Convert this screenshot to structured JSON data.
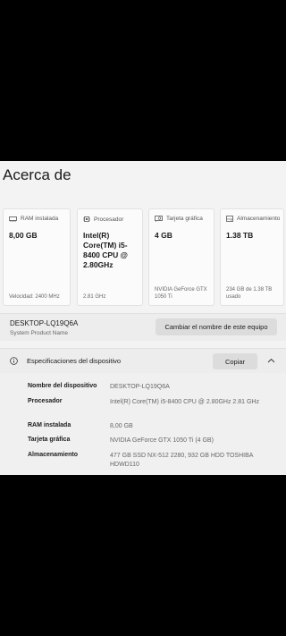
{
  "page": {
    "title": "Acerca de"
  },
  "cards": [
    {
      "header": "RAM instalada",
      "icon": "memory-icon",
      "main": "8,00 GB",
      "sub": "Velocidad: 2400 MHz"
    },
    {
      "header": "Procesador",
      "icon": "cpu-icon",
      "main": "Intel(R) Core(TM) i5-8400 CPU @ 2.80GHz",
      "sub": "2.81 GHz"
    },
    {
      "header": "Tarjeta gráfica",
      "icon": "gpu-icon",
      "main": "4 GB",
      "sub": "NVIDIA GeForce GTX 1050 Ti"
    },
    {
      "header": "Almacenamiento",
      "icon": "storage-icon",
      "main": "1.38 TB",
      "sub": "234 GB de 1.38 TB usado"
    }
  ],
  "device": {
    "name": "DESKTOP-LQ19Q6A",
    "product": "System Product Name",
    "rename_label": "Cambiar el nombre de este equipo"
  },
  "specs": {
    "title": "Especificaciones del dispositivo",
    "copy_label": "Copiar",
    "rows": [
      {
        "key": "Nombre del dispositivo",
        "value": "DESKTOP-LQ19Q6A"
      },
      {
        "key": "Procesador",
        "value": "Intel(R) Core(TM) i5-8400 CPU @ 2.80GHz   2.81 GHz"
      },
      {
        "key": "RAM instalada",
        "value": "8,00 GB"
      },
      {
        "key": "Tarjeta gráfica",
        "value": "NVIDIA GeForce GTX 1050 Ti (4 GB)"
      },
      {
        "key": "Almacenamiento",
        "value": "477 GB SSD NX-512 2280, 932 GB HDD TOSHIBA HDWD110"
      }
    ]
  }
}
